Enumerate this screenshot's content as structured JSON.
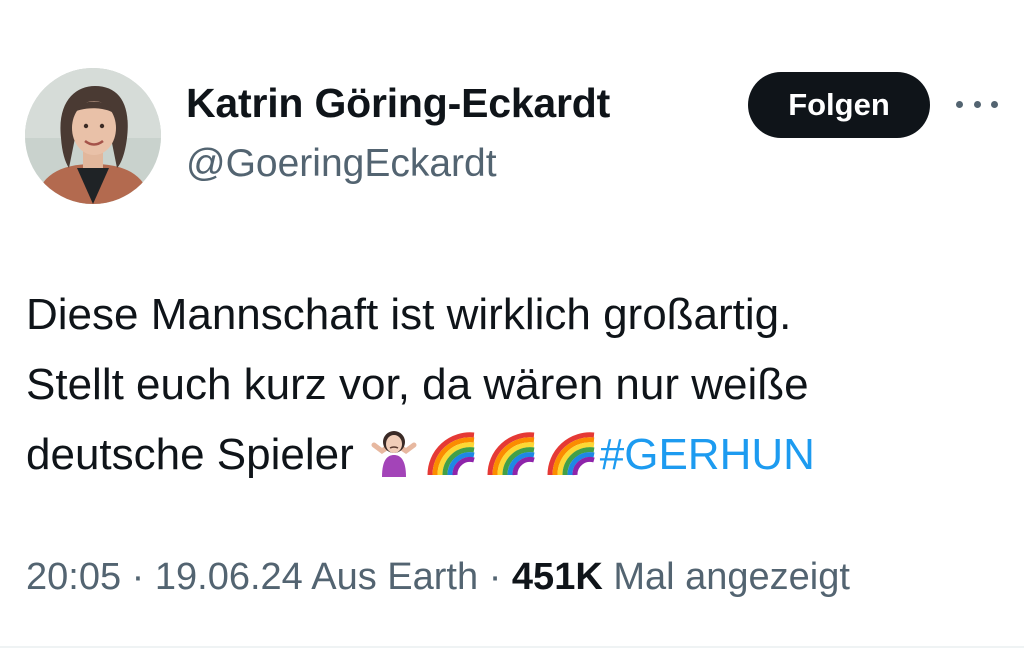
{
  "author": {
    "display_name": "Katrin Göring-Eckardt",
    "handle": "@GoeringEckardt",
    "avatar_icon": "profile-photo"
  },
  "actions": {
    "follow_label": "Folgen",
    "more_icon": "more-horizontal-icon"
  },
  "tweet": {
    "line1": "Diese Mannschaft ist wirklich großartig.",
    "line2": "Stellt euch kurz vor, da wären nur weiße",
    "line3_text": "deutsche Spieler",
    "emojis": [
      "person-shrugging-emoji",
      "rainbow-emoji",
      "rainbow-emoji",
      "rainbow-emoji"
    ],
    "hashtag": "#GERHUN"
  },
  "meta": {
    "time": "20:05",
    "sep1": "·",
    "date": "19.06.24",
    "source": "Aus Earth",
    "sep2": "·",
    "views_count": "451K",
    "views_label": "Mal angezeigt"
  },
  "colors": {
    "text": "#0f1419",
    "secondary": "#536471",
    "link": "#1d9bf0",
    "button_bg": "#0f1419"
  }
}
